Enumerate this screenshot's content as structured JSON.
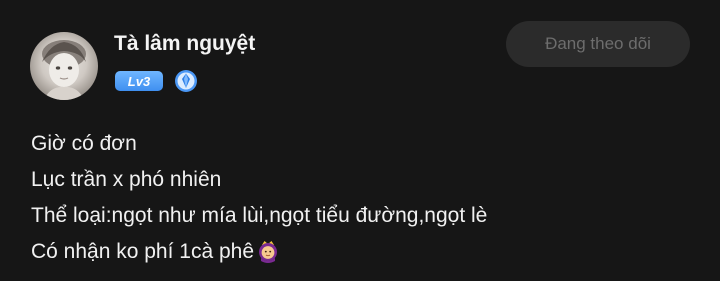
{
  "post": {
    "author": {
      "name": "Tà lâm nguyệt",
      "level": "Lv3",
      "avatar_icon": "avatar-image",
      "rank_icon": "rank-diamond-icon"
    },
    "follow_button_label": "Đang theo dõi",
    "content_lines": [
      "Giờ có đơn",
      "Lục trần x phó nhiên",
      "Thể loại:ngọt như mía lùi,ngọt tiểu đường,ngọt lè",
      "Có nhận ko phí 1cà phê"
    ],
    "trailing_emoji": "woman-with-crown-emoji"
  },
  "colors": {
    "background": "#161616",
    "level_badge": "#4a97f5",
    "follow_button_bg": "#2b2b2b",
    "follow_button_text": "#6d6d6d",
    "text": "#f1f1f1"
  }
}
